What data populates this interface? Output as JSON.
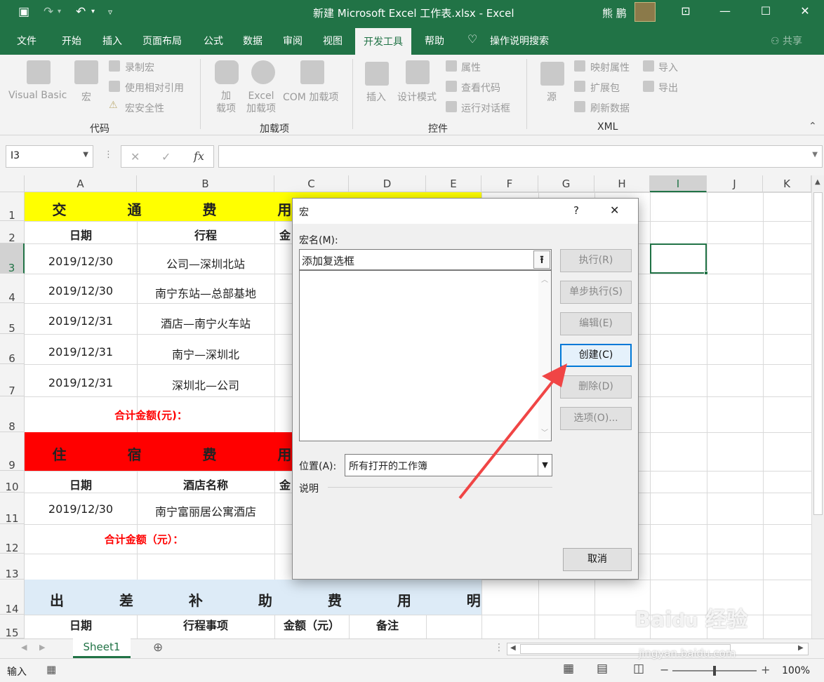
{
  "window": {
    "title": "新建 Microsoft Excel 工作表.xlsx  -  Excel",
    "user": "熊 鹏"
  },
  "ribbon_tabs": [
    "文件",
    "开始",
    "插入",
    "页面布局",
    "公式",
    "数据",
    "审阅",
    "视图",
    "开发工具",
    "帮助"
  ],
  "tell_me": "操作说明搜索",
  "share": "共享",
  "ribbon": {
    "code": {
      "visual_basic": "Visual Basic",
      "macros": "宏",
      "record_macro": "录制宏",
      "relative_ref": "使用相对引用",
      "macro_security": "宏安全性",
      "group": "代码"
    },
    "addins": {
      "addins": "加\n载项",
      "excel_addins": "Excel\n加载项",
      "com_addins": "COM 加载项",
      "group": "加载项"
    },
    "controls": {
      "insert": "插入",
      "design_mode": "设计模式",
      "properties": "属性",
      "view_code": "查看代码",
      "run_dialog": "运行对话框",
      "group": "控件"
    },
    "xml": {
      "source": "源",
      "map_props": "映射属性",
      "expansion": "扩展包",
      "refresh": "刷新数据",
      "import": "导入",
      "export": "导出",
      "group": "XML"
    }
  },
  "name_box": "I3",
  "formula_fx": "fx",
  "columns": [
    "A",
    "B",
    "C",
    "D",
    "E",
    "F",
    "G",
    "H",
    "I",
    "J",
    "K"
  ],
  "rows": [
    "1",
    "2",
    "3",
    "4",
    "5",
    "6",
    "7",
    "8",
    "9",
    "10",
    "11",
    "12",
    "13",
    "14",
    "15"
  ],
  "sheet": {
    "r1_title": "交 通 费 用",
    "r2": {
      "a": "日期",
      "b": "行程",
      "c": "金"
    },
    "trips": [
      {
        "date": "2019/12/30",
        "route": "公司—深圳北站"
      },
      {
        "date": "2019/12/30",
        "route": "南宁东站—总部基地"
      },
      {
        "date": "2019/12/31",
        "route": "酒店—南宁火车站"
      },
      {
        "date": "2019/12/31",
        "route": "南宁—深圳北"
      },
      {
        "date": "2019/12/31",
        "route": "深圳北—公司"
      }
    ],
    "r8_total": "合计金额(元)：",
    "r9_title": "住 宿 费 用",
    "r10": {
      "a": "日期",
      "b": "酒店名称",
      "c": "金"
    },
    "r11": {
      "date": "2019/12/30",
      "hotel": "南宁富丽居公寓酒店"
    },
    "r12_total": "合计金额（元）：",
    "r14_title": "出 差 补 助 费 用 明 细",
    "r15": {
      "a": "日期",
      "b": "行程事项",
      "c": "金额（元）",
      "d": "备注"
    }
  },
  "dialog": {
    "title": "宏",
    "help": "?",
    "close": "✕",
    "macro_name_label": "宏名(M):",
    "macro_name_value": "添加复选框",
    "buttons": {
      "run": "执行(R)",
      "step": "单步执行(S)",
      "edit": "编辑(E)",
      "create": "创建(C)",
      "delete": "删除(D)",
      "options": "选项(O)...",
      "cancel": "取消"
    },
    "location_label": "位置(A):",
    "location_value": "所有打开的工作簿",
    "description_label": "说明"
  },
  "sheet_tab": "Sheet1",
  "status": {
    "mode": "输入",
    "zoom": "100%"
  },
  "watermark": "Bai du 经验 jingyan.baidu.com",
  "colors": {
    "excel_green": "#217346",
    "yellow_header": "#ffff00",
    "red_header": "#ff0000",
    "blue_header": "#ddebf7",
    "total_red": "#ff0000",
    "arrow": "#f04545"
  }
}
